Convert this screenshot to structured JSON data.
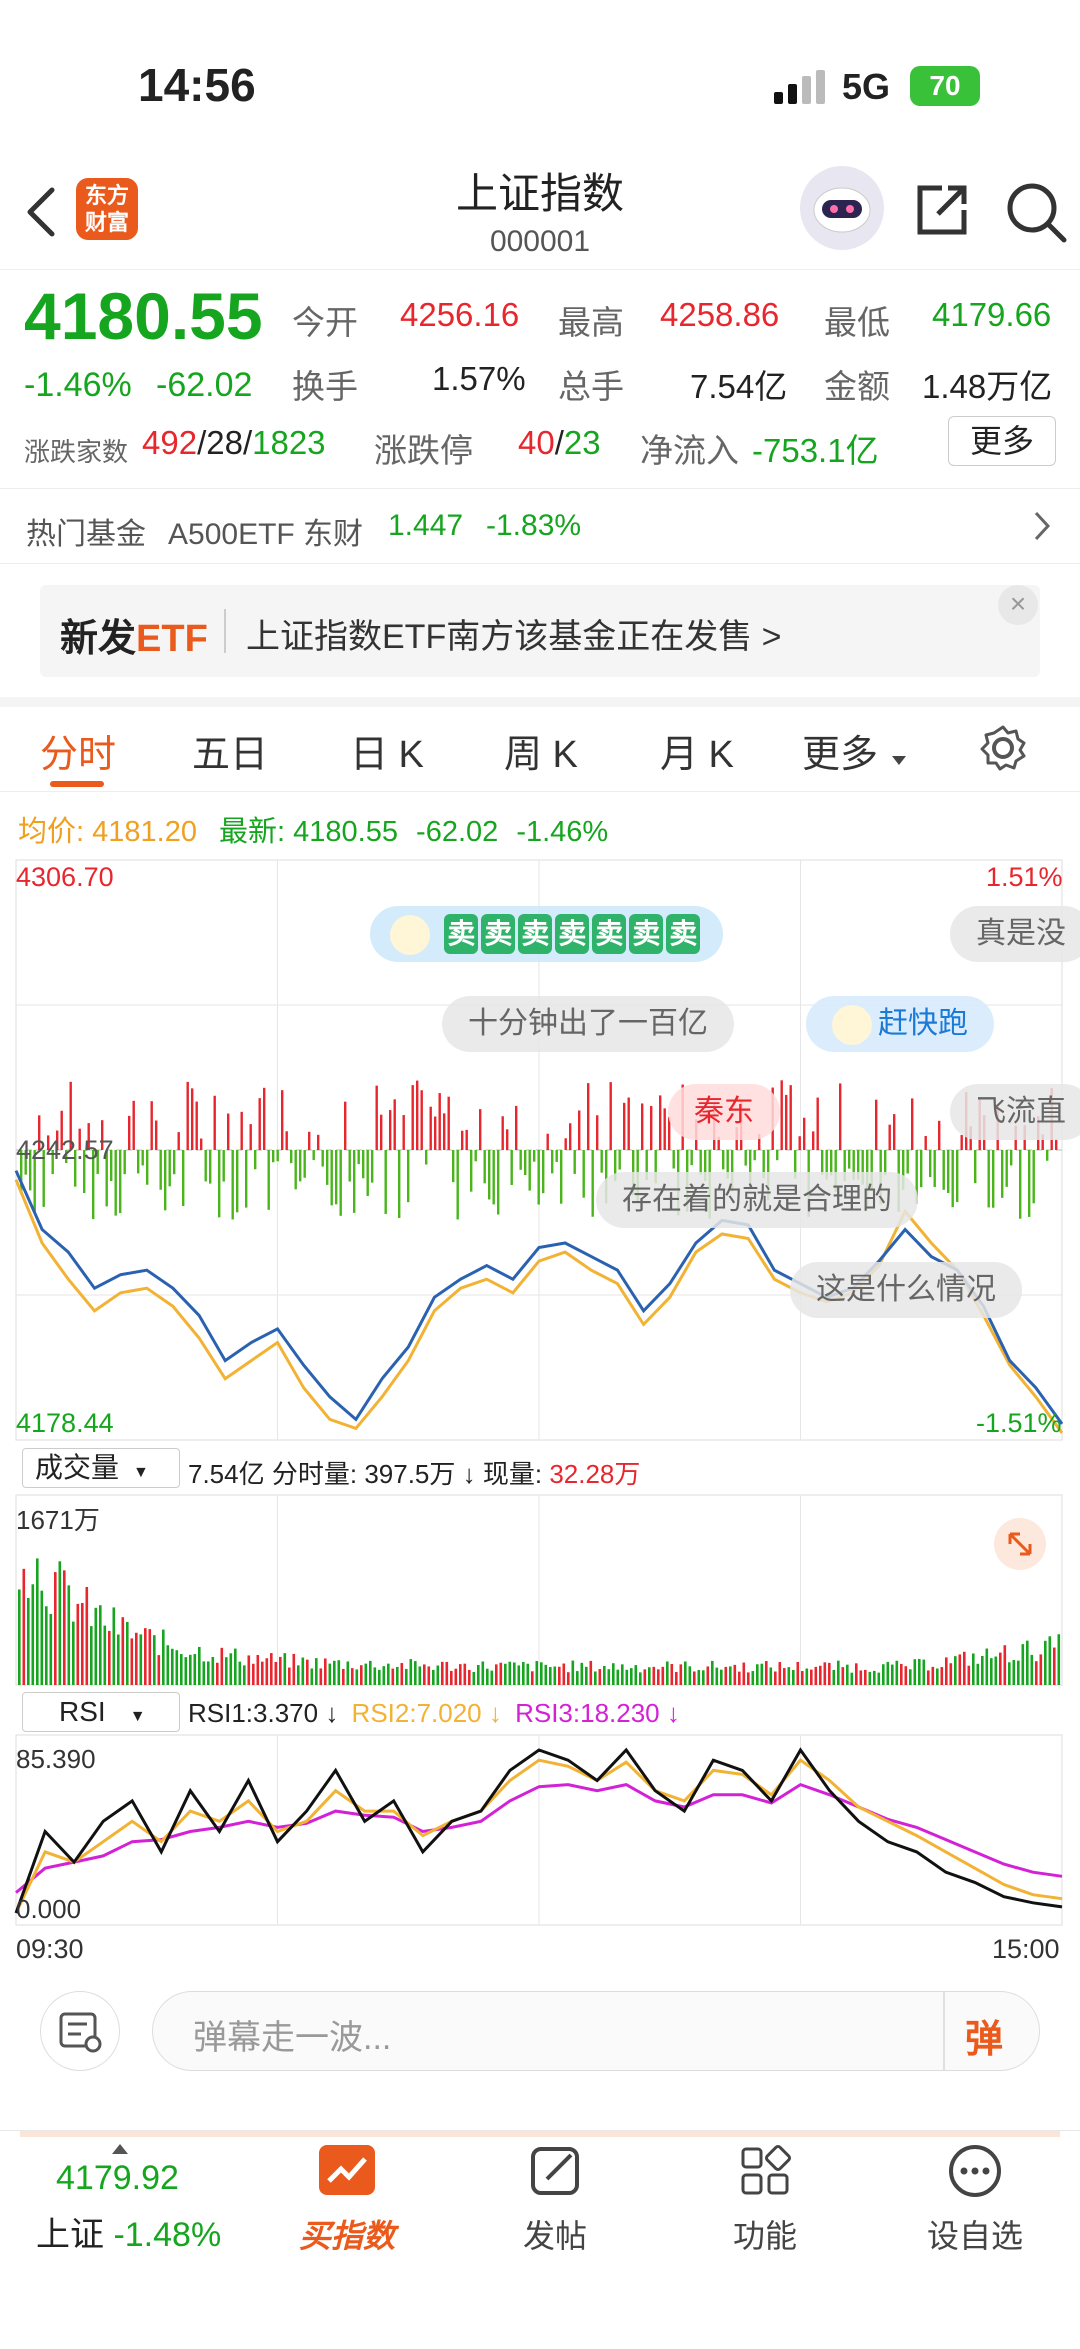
{
  "status": {
    "time": "14:56",
    "network": "5G",
    "battery": "70"
  },
  "nav": {
    "logo_line1": "东方",
    "logo_line2": "财富",
    "title": "上证指数",
    "code": "000001"
  },
  "quote": {
    "price": "4180.55",
    "change_pct": "-1.46%",
    "change": "-62.02",
    "open_label": "今开",
    "open": "4256.16",
    "high_label": "最高",
    "high": "4258.86",
    "low_label": "最低",
    "low": "4179.66",
    "turnover_label": "换手",
    "turnover": "1.57%",
    "volume_label": "总手",
    "volume": "7.54亿",
    "amount_label": "金额",
    "amount": "1.48万亿",
    "breadth_label": "涨跌家数",
    "breadth_up": "492",
    "breadth_flat": "28",
    "breadth_down": "1823",
    "limit_label": "涨跌停",
    "limit_up": "40",
    "limit_down": "23",
    "flow_label": "净流入",
    "flow": "-753.1亿",
    "more_label": "更多"
  },
  "hot_fund": {
    "label": "热门基金",
    "name": "A500ETF 东财",
    "price": "1.447",
    "change": "-1.83%"
  },
  "banner": {
    "tag_new": "新发",
    "tag_etf": "ETF",
    "text": "上证指数ETF南方该基金正在发售 >"
  },
  "tabs": [
    "分时",
    "五日",
    "日 K",
    "周 K",
    "月 K",
    "更多"
  ],
  "chart_header": {
    "avg_label": "均价:",
    "avg": "4181.20",
    "last_label": "最新:",
    "last": "4180.55",
    "chg": "-62.02",
    "pct": "-1.46%"
  },
  "price_axis": {
    "top": "4306.70",
    "mid": "4242.57",
    "bottom": "4178.44",
    "top_pct": "1.51%",
    "bottom_pct": "-1.51%"
  },
  "danmaku": {
    "sell_chars": [
      "卖",
      "卖",
      "卖",
      "卖",
      "卖",
      "卖",
      "卖"
    ],
    "msgs": [
      "真是没",
      "十分钟出了一百亿",
      "赶快跑",
      "秦东",
      "飞流直",
      "存在着的就是合理的",
      "这是什么情况"
    ]
  },
  "volume_panel": {
    "selector": "成交量",
    "total": "7.54亿",
    "min_label": "分时量:",
    "min_vol": "397.5万",
    "cur_label": "现量:",
    "cur_vol": "32.28万",
    "max": "1671万"
  },
  "rsi_panel": {
    "selector": "RSI",
    "rsi1": "RSI1:3.370 ↓",
    "rsi2": "RSI2:7.020 ↓",
    "rsi3": "RSI3:18.230 ↓",
    "max": "85.390",
    "min": "0.000"
  },
  "time_axis": {
    "start": "09:30",
    "end": "15:00"
  },
  "comment": {
    "placeholder": "弹幕走一波...",
    "send": "弹"
  },
  "tabbar": {
    "index_price": "4179.92",
    "index_name": "上证",
    "index_pct": "-1.48%",
    "items": [
      "买指数",
      "发帖",
      "功能",
      "设自选"
    ]
  },
  "colors": {
    "up": "#e8262d",
    "down": "#16a51f",
    "accent": "#f0601e",
    "price_line": "#2a62b0",
    "avg_line": "#f2b233",
    "rsi3": "#d322d6"
  },
  "chart_data": {
    "type": "line",
    "title": "",
    "x": [
      "09:30",
      "15:00"
    ],
    "series": [
      {
        "name": "price",
        "values": [
          4238,
          4225,
          4220,
          4212,
          4215,
          4216,
          4212,
          4206,
          4196,
          4200,
          4203,
          4195,
          4188,
          4183,
          4192,
          4199,
          4210,
          4214,
          4217,
          4214,
          4221,
          4222,
          4219,
          4216,
          4207,
          4213,
          4222,
          4227,
          4226,
          4216,
          4213,
          4210,
          4212,
          4218,
          4225,
          4219,
          4216,
          4208,
          4196,
          4190,
          4182
        ]
      },
      {
        "name": "avg",
        "values": [
          4236,
          4222,
          4214,
          4207,
          4211,
          4212,
          4208,
          4201,
          4192,
          4196,
          4200,
          4190,
          4183,
          4181,
          4188,
          4196,
          4207,
          4212,
          4214,
          4211,
          4218,
          4220,
          4216,
          4213,
          4204,
          4210,
          4220,
          4224,
          4223,
          4214,
          4211,
          4209,
          4211,
          4217,
          4229,
          4222,
          4216,
          4206,
          4195,
          4188,
          4180
        ]
      }
    ],
    "ylim": [
      4178.44,
      4306.7
    ],
    "volume_max": "1671万",
    "rsi": {
      "ylim": [
        0,
        85.39
      ],
      "RSI1": [
        0,
        40,
        25,
        45,
        55,
        30,
        60,
        40,
        65,
        35,
        50,
        70,
        45,
        55,
        30,
        45,
        50,
        70,
        80,
        75,
        65,
        80,
        60,
        50,
        75,
        70,
        55,
        80,
        60,
        45,
        35,
        30,
        20,
        15,
        8,
        5,
        3
      ],
      "RSI2": [
        0,
        30,
        25,
        35,
        45,
        35,
        50,
        45,
        55,
        40,
        45,
        60,
        50,
        50,
        38,
        45,
        50,
        65,
        75,
        72,
        65,
        74,
        60,
        55,
        70,
        68,
        58,
        75,
        65,
        52,
        45,
        38,
        30,
        22,
        14,
        9,
        7
      ],
      "RSI3": [
        10,
        22,
        25,
        28,
        35,
        36,
        40,
        42,
        45,
        42,
        44,
        50,
        48,
        47,
        40,
        42,
        45,
        55,
        62,
        63,
        60,
        63,
        55,
        52,
        58,
        58,
        54,
        63,
        58,
        52,
        46,
        42,
        36,
        30,
        24,
        20,
        18
      ]
    }
  }
}
